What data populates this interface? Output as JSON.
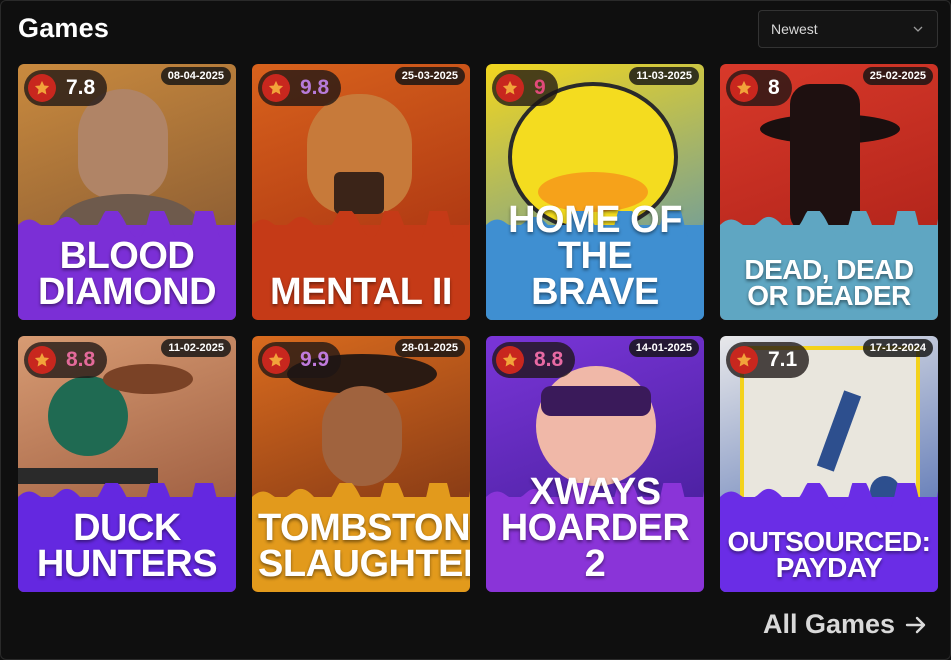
{
  "header": {
    "title": "Games",
    "sort": {
      "selected": "Newest"
    }
  },
  "games": [
    {
      "title": "BLOOD\nDIAMOND",
      "rating": "7.8",
      "date": "08-04-2025",
      "rating_color": "#ffffff",
      "bg": [
        "#c98a3e",
        "#7a5030"
      ],
      "splash": "#7b2fd6"
    },
    {
      "title": "MENTAL II",
      "rating": "9.8",
      "date": "25-03-2025",
      "rating_color": "#b77bd9",
      "bg": [
        "#d8621c",
        "#a12a10"
      ],
      "splash": "#c53a17"
    },
    {
      "title": "HOME OF\nTHE BRAVE",
      "rating": "9",
      "date": "11-03-2025",
      "rating_color": "#e24a7a",
      "bg": [
        "#f2d61e",
        "#4c8dbd"
      ],
      "splash": "#3f8fd1"
    },
    {
      "title": "DEAD, DEAD\nOR DEADER",
      "rating": "8",
      "date": "25-02-2025",
      "rating_color": "#ffffff",
      "bg": [
        "#d8392a",
        "#a61e16"
      ],
      "splash": "#5fa6c2"
    },
    {
      "title": "DUCK\nHUNTERS",
      "rating": "8.8",
      "date": "11-02-2025",
      "rating_color": "#e36a9a",
      "bg": [
        "#d79b73",
        "#8c4a30"
      ],
      "splash": "#6428e0"
    },
    {
      "title": "TOMBSTONE\nSLAUGHTER",
      "rating": "9.9",
      "date": "28-01-2025",
      "rating_color": "#c07bdc",
      "bg": [
        "#d96b1e",
        "#6b2a12"
      ],
      "splash": "#e29a1c"
    },
    {
      "title": "XWAYS\nHOARDER 2",
      "rating": "8.8",
      "date": "14-01-2025",
      "rating_color": "#e86aa3",
      "bg": [
        "#7a35d8",
        "#3c1a8f"
      ],
      "splash": "#8a34d8"
    },
    {
      "title": "OUTSOURCED:\nPAYDAY",
      "rating": "7.1",
      "date": "17-12-2024",
      "rating_color": "#ffffff",
      "bg": [
        "#e8e8ea",
        "#3a5ba8"
      ],
      "splash": "#6a2de6"
    }
  ],
  "footer": {
    "all_games_label": "All Games"
  },
  "icons": {
    "rating": "star-icon",
    "sort": "chevron-down-icon",
    "all_games": "arrow-right-icon"
  }
}
